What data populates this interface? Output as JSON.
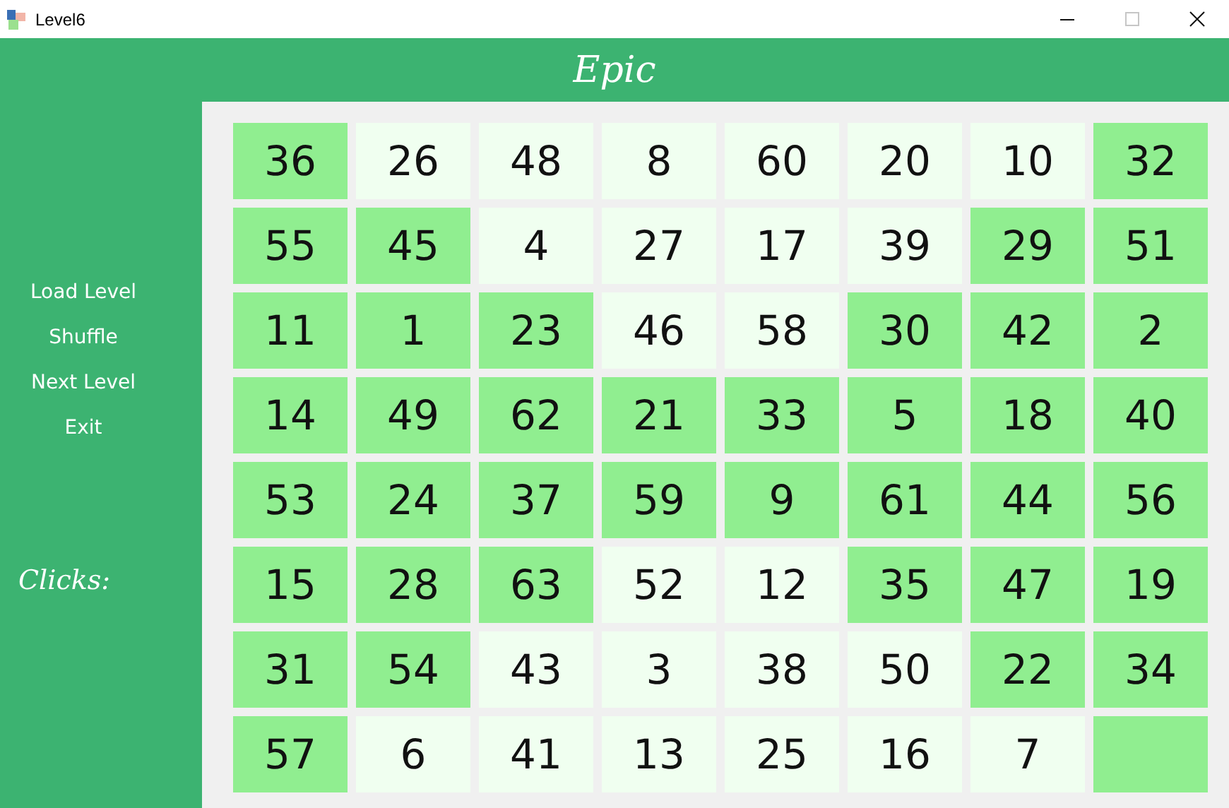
{
  "window": {
    "title": "Level6",
    "controls": [
      {
        "kind": "minimize",
        "disabled": false
      },
      {
        "kind": "maximize",
        "disabled": true
      },
      {
        "kind": "close",
        "disabled": false
      }
    ]
  },
  "header": {
    "title": "Epic"
  },
  "sidebar": {
    "items": [
      {
        "label": "Load Level"
      },
      {
        "label": "Shuffle"
      },
      {
        "label": "Next Level"
      },
      {
        "label": "Exit"
      }
    ],
    "clicks_label": "Clicks:"
  },
  "board": {
    "tiles": [
      {
        "kind": "number",
        "text": "36",
        "highlighted": true
      },
      {
        "kind": "number",
        "text": "26",
        "highlighted": false
      },
      {
        "kind": "number",
        "text": "48",
        "highlighted": false
      },
      {
        "kind": "number",
        "text": "8",
        "highlighted": false
      },
      {
        "kind": "number",
        "text": "60",
        "highlighted": false
      },
      {
        "kind": "number",
        "text": "20",
        "highlighted": false
      },
      {
        "kind": "number",
        "text": "10",
        "highlighted": false
      },
      {
        "kind": "number",
        "text": "32",
        "highlighted": true
      },
      {
        "kind": "number",
        "text": "55",
        "highlighted": true
      },
      {
        "kind": "number",
        "text": "45",
        "highlighted": true
      },
      {
        "kind": "number",
        "text": "4",
        "highlighted": false
      },
      {
        "kind": "number",
        "text": "27",
        "highlighted": false
      },
      {
        "kind": "number",
        "text": "17",
        "highlighted": false
      },
      {
        "kind": "number",
        "text": "39",
        "highlighted": false
      },
      {
        "kind": "number",
        "text": "29",
        "highlighted": true
      },
      {
        "kind": "number",
        "text": "51",
        "highlighted": true
      },
      {
        "kind": "number",
        "text": "11",
        "highlighted": true
      },
      {
        "kind": "number",
        "text": "1",
        "highlighted": true
      },
      {
        "kind": "number",
        "text": "23",
        "highlighted": true
      },
      {
        "kind": "number",
        "text": "46",
        "highlighted": false
      },
      {
        "kind": "number",
        "text": "58",
        "highlighted": false
      },
      {
        "kind": "number",
        "text": "30",
        "highlighted": true
      },
      {
        "kind": "number",
        "text": "42",
        "highlighted": true
      },
      {
        "kind": "number",
        "text": "2",
        "highlighted": true
      },
      {
        "kind": "number",
        "text": "14",
        "highlighted": true
      },
      {
        "kind": "number",
        "text": "49",
        "highlighted": true
      },
      {
        "kind": "number",
        "text": "62",
        "highlighted": true
      },
      {
        "kind": "number",
        "text": "21",
        "highlighted": true
      },
      {
        "kind": "number",
        "text": "33",
        "highlighted": true
      },
      {
        "kind": "number",
        "text": "5",
        "highlighted": true
      },
      {
        "kind": "number",
        "text": "18",
        "highlighted": true
      },
      {
        "kind": "number",
        "text": "40",
        "highlighted": true
      },
      {
        "kind": "number",
        "text": "53",
        "highlighted": true
      },
      {
        "kind": "number",
        "text": "24",
        "highlighted": true
      },
      {
        "kind": "number",
        "text": "37",
        "highlighted": true
      },
      {
        "kind": "number",
        "text": "59",
        "highlighted": true
      },
      {
        "kind": "number",
        "text": "9",
        "highlighted": true
      },
      {
        "kind": "number",
        "text": "61",
        "highlighted": true
      },
      {
        "kind": "number",
        "text": "44",
        "highlighted": true
      },
      {
        "kind": "number",
        "text": "56",
        "highlighted": true
      },
      {
        "kind": "number",
        "text": "15",
        "highlighted": true
      },
      {
        "kind": "number",
        "text": "28",
        "highlighted": true
      },
      {
        "kind": "number",
        "text": "63",
        "highlighted": true
      },
      {
        "kind": "number",
        "text": "52",
        "highlighted": false
      },
      {
        "kind": "number",
        "text": "12",
        "highlighted": false
      },
      {
        "kind": "number",
        "text": "35",
        "highlighted": true
      },
      {
        "kind": "number",
        "text": "47",
        "highlighted": true
      },
      {
        "kind": "number",
        "text": "19",
        "highlighted": true
      },
      {
        "kind": "number",
        "text": "31",
        "highlighted": true
      },
      {
        "kind": "number",
        "text": "54",
        "highlighted": true
      },
      {
        "kind": "number",
        "text": "43",
        "highlighted": false
      },
      {
        "kind": "number",
        "text": "3",
        "highlighted": false
      },
      {
        "kind": "number",
        "text": "38",
        "highlighted": false
      },
      {
        "kind": "number",
        "text": "50",
        "highlighted": false
      },
      {
        "kind": "number",
        "text": "22",
        "highlighted": true
      },
      {
        "kind": "number",
        "text": "34",
        "highlighted": true
      },
      {
        "kind": "number",
        "text": "57",
        "highlighted": true
      },
      {
        "kind": "number",
        "text": "6",
        "highlighted": false
      },
      {
        "kind": "number",
        "text": "41",
        "highlighted": false
      },
      {
        "kind": "number",
        "text": "13",
        "highlighted": false
      },
      {
        "kind": "number",
        "text": "25",
        "highlighted": false
      },
      {
        "kind": "number",
        "text": "16",
        "highlighted": false
      },
      {
        "kind": "number",
        "text": "7",
        "highlighted": false
      },
      {
        "kind": "empty",
        "highlighted": true
      }
    ]
  }
}
